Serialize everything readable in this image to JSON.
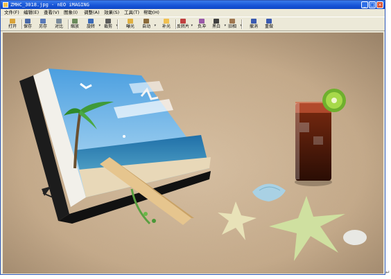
{
  "window": {
    "title": "ZMHC_3018.jpg - nEO iMAGING",
    "minimize_glyph": "_",
    "maximize_glyph": "□",
    "close_glyph": "×"
  },
  "menu": [
    {
      "label": "文件(F)"
    },
    {
      "label": "编辑(E)"
    },
    {
      "label": "查看(V)"
    },
    {
      "label": "图象(I)"
    },
    {
      "label": "调整(A)"
    },
    {
      "label": "效果(S)"
    },
    {
      "label": "工具(T)"
    },
    {
      "label": "帮助(H)"
    }
  ],
  "toolbar": [
    {
      "label": "打开",
      "icon": "open-folder-icon",
      "color": "#d9a43a"
    },
    {
      "label": "保存",
      "icon": "save-disk-icon",
      "color": "#4a6aa8"
    },
    {
      "label": "另存",
      "icon": "save-as-icon",
      "color": "#5a7ab8"
    },
    {
      "label": "对比",
      "icon": "compare-icon",
      "color": "#7a8a9a"
    },
    {
      "label": "缩放",
      "icon": "zoom-icon",
      "color": "#6a8a5a"
    },
    {
      "label": "旋转",
      "icon": "rotate-icon",
      "color": "#3a6ab8",
      "dropdown": true
    },
    {
      "label": "裁剪",
      "icon": "crop-icon",
      "color": "#5a5a5a",
      "dropdown": true
    },
    {
      "label": "曝光",
      "icon": "exposure-icon",
      "color": "#e0b040"
    },
    {
      "label": "自动",
      "icon": "auto-icon",
      "color": "#8a6a3a",
      "dropdown": true
    },
    {
      "label": "补光",
      "icon": "fill-light-icon",
      "color": "#f0c050"
    },
    {
      "label": "反转片",
      "icon": "reversal-film-icon",
      "color": "#c04040",
      "dropdown": true
    },
    {
      "label": "负冲",
      "icon": "cross-process-icon",
      "color": "#9a5aa8"
    },
    {
      "label": "黑白",
      "icon": "black-white-icon",
      "color": "#404040",
      "dropdown": true
    },
    {
      "label": "旧相",
      "icon": "old-photo-icon",
      "color": "#a07850",
      "dropdown": true
    },
    {
      "label": "撤消",
      "icon": "undo-icon",
      "color": "#3a5ab0"
    },
    {
      "label": "重做",
      "icon": "redo-icon",
      "color": "#3a5ab0"
    }
  ],
  "canvas": {
    "image": "beach-photo",
    "sand_color": "#c8ae8f",
    "sky_color": "#6eb4e8",
    "sea_color": "#2f7fb0"
  },
  "status": {
    "return_mark": "↵"
  }
}
